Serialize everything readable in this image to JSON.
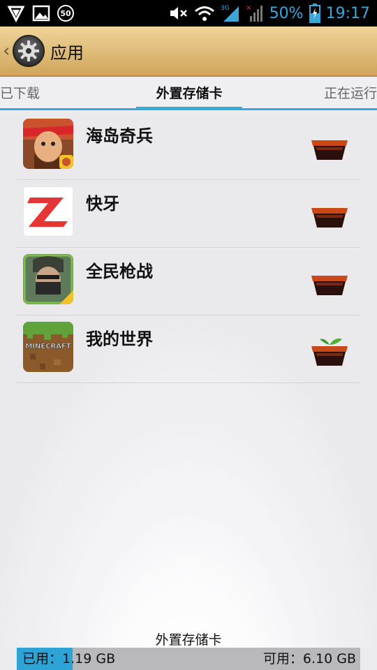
{
  "status_bar": {
    "notification_badge": "50",
    "battery_percent": "50%",
    "time": "19:17",
    "network": "3G",
    "icons": [
      "vpn-icon",
      "image-icon",
      "notification-badge-icon",
      "mute-icon",
      "wifi-icon",
      "signal-3g-icon",
      "signal-no-service-icon",
      "battery-charging-icon"
    ]
  },
  "title_bar": {
    "title": "应用",
    "back_glyph": "‹",
    "icon": "settings-gear-icon"
  },
  "tabs": [
    {
      "label": "已下载",
      "selected": false
    },
    {
      "label": "外置存储卡",
      "selected": true
    },
    {
      "label": "正在运行",
      "selected": false
    }
  ],
  "apps": [
    {
      "name": "海岛奇兵",
      "icon": "boom-beach-icon",
      "status_icon": "empty-pot-icon"
    },
    {
      "name": "快牙",
      "icon": "zapya-icon",
      "status_icon": "empty-pot-icon"
    },
    {
      "name": "全民枪战",
      "icon": "soldier-game-icon",
      "status_icon": "empty-pot-icon"
    },
    {
      "name": "我的世界",
      "icon": "minecraft-icon",
      "status_icon": "sprout-pot-icon",
      "icon_text": "MINECRAFT"
    }
  ],
  "storage": {
    "title": "外置存储卡",
    "used_label": "已用：1.19 GB",
    "free_label": "可用：6.10 GB",
    "used_fraction": 0.163
  },
  "colors": {
    "accent": "#33aad9",
    "title_bar": "#dcb46c",
    "status_blue": "#3aa7d9"
  }
}
